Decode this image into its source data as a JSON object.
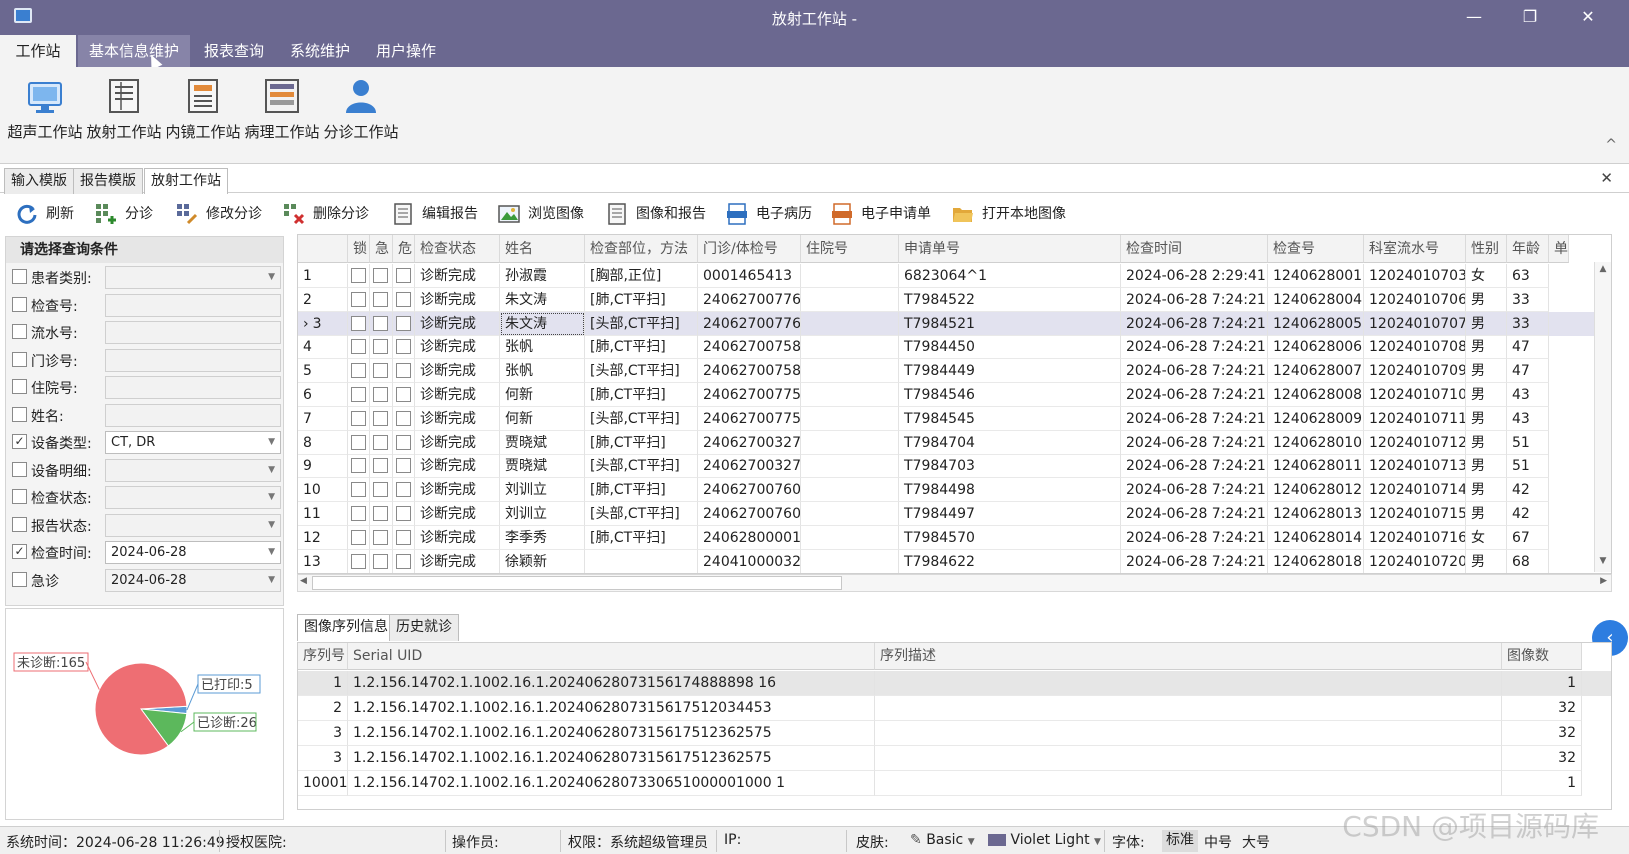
{
  "window": {
    "title": "放射工作站 -",
    "minimize": "—",
    "maximize": "❐",
    "close": "✕"
  },
  "menu": [
    "工作站",
    "基本信息维护",
    "报表查询",
    "系统维护",
    "用户操作"
  ],
  "ribbon": {
    "buttons": [
      {
        "label": "超声工作站",
        "icon": "monitor-icon"
      },
      {
        "label": "放射工作站",
        "icon": "document-icon"
      },
      {
        "label": "内镜工作站",
        "icon": "list-icon"
      },
      {
        "label": "病理工作站",
        "icon": "table-icon"
      },
      {
        "label": "分诊工作站",
        "icon": "user-icon"
      }
    ],
    "collapse": "^"
  },
  "doc_tabs": [
    "输入模版",
    "报告模版",
    "放射工作站"
  ],
  "doc_close": "✕",
  "toolbar": [
    "刷新",
    "分诊",
    "修改分诊",
    "删除分诊",
    "编辑报告",
    "浏览图像",
    "图像和报告",
    "电子病历",
    "电子申请单",
    "打开本地图像"
  ],
  "filters": {
    "header": "请选择查询条件",
    "rows": [
      {
        "label": "患者类别:",
        "checked": false,
        "value": "",
        "dropdown": true
      },
      {
        "label": "检查号:",
        "checked": false,
        "value": "",
        "dropdown": false
      },
      {
        "label": "流水号:",
        "checked": false,
        "value": "",
        "dropdown": false
      },
      {
        "label": "门诊号:",
        "checked": false,
        "value": "",
        "dropdown": false
      },
      {
        "label": "住院号:",
        "checked": false,
        "value": "",
        "dropdown": false
      },
      {
        "label": "姓名:",
        "checked": false,
        "value": "",
        "dropdown": false
      },
      {
        "label": "设备类型:",
        "checked": true,
        "value": "CT, DR",
        "dropdown": true
      },
      {
        "label": "设备明细:",
        "checked": false,
        "value": "",
        "dropdown": true
      },
      {
        "label": "检查状态:",
        "checked": false,
        "value": "",
        "dropdown": true
      },
      {
        "label": "报告状态:",
        "checked": false,
        "value": "",
        "dropdown": true
      },
      {
        "label": "检查时间:",
        "checked": true,
        "value": "2024-06-28",
        "dropdown": true
      },
      {
        "label": "急诊",
        "checked": false,
        "value": "2024-06-28",
        "dropdown": true
      }
    ]
  },
  "pie": {
    "labels": {
      "undiagnosed": "未诊断:165",
      "printed": "已打印:5",
      "diagnosed": "已诊断:26"
    },
    "values": {
      "undiagnosed": 165,
      "printed": 5,
      "diagnosed": 26
    },
    "colors": {
      "undiagnosed": "#ee6e73",
      "printed": "#5b9bd5",
      "diagnosed": "#5cb85c"
    }
  },
  "grid": {
    "columns": [
      "",
      "锁",
      "急",
      "危",
      "检查状态",
      "姓名",
      "检查部位，方法",
      "门诊/体检号",
      "住院号",
      "申请单号",
      "检查时间",
      "检查号",
      "科室流水号",
      "性别",
      "年龄",
      "单"
    ],
    "rows": [
      [
        "1",
        "诊断完成",
        "孙淑霞",
        "[胸部,正位]",
        "0001465413",
        "",
        "6823064^1",
        "2024-06-28 2:29:41",
        "1240628001",
        "12024010703",
        "女",
        "63"
      ],
      [
        "2",
        "诊断完成",
        "朱文涛",
        "[肺,CT平扫]",
        "24062700776",
        "",
        "T7984522",
        "2024-06-28 7:24:21",
        "1240628004",
        "12024010706",
        "男",
        "33"
      ],
      [
        "3",
        "诊断完成",
        "朱文涛",
        "[头部,CT平扫]",
        "24062700776",
        "",
        "T7984521",
        "2024-06-28 7:24:21",
        "1240628005",
        "12024010707",
        "男",
        "33"
      ],
      [
        "4",
        "诊断完成",
        "张帆",
        "[肺,CT平扫]",
        "24062700758",
        "",
        "T7984450",
        "2024-06-28 7:24:21",
        "1240628006",
        "12024010708",
        "男",
        "47"
      ],
      [
        "5",
        "诊断完成",
        "张帆",
        "[头部,CT平扫]",
        "24062700758",
        "",
        "T7984449",
        "2024-06-28 7:24:21",
        "1240628007",
        "12024010709",
        "男",
        "47"
      ],
      [
        "6",
        "诊断完成",
        "何新",
        "[肺,CT平扫]",
        "24062700775",
        "",
        "T7984546",
        "2024-06-28 7:24:21",
        "1240628008",
        "12024010710",
        "男",
        "43"
      ],
      [
        "7",
        "诊断完成",
        "何新",
        "[头部,CT平扫]",
        "24062700775",
        "",
        "T7984545",
        "2024-06-28 7:24:21",
        "1240628009",
        "12024010711",
        "男",
        "43"
      ],
      [
        "8",
        "诊断完成",
        "贾晓斌",
        "[肺,CT平扫]",
        "24062700327",
        "",
        "T7984704",
        "2024-06-28 7:24:21",
        "1240628010",
        "12024010712",
        "男",
        "51"
      ],
      [
        "9",
        "诊断完成",
        "贾晓斌",
        "[头部,CT平扫]",
        "24062700327",
        "",
        "T7984703",
        "2024-06-28 7:24:21",
        "1240628011",
        "12024010713",
        "男",
        "51"
      ],
      [
        "10",
        "诊断完成",
        "刘训立",
        "[肺,CT平扫]",
        "24062700760",
        "",
        "T7984498",
        "2024-06-28 7:24:21",
        "1240628012",
        "12024010714",
        "男",
        "42"
      ],
      [
        "11",
        "诊断完成",
        "刘训立",
        "[头部,CT平扫]",
        "24062700760",
        "",
        "T7984497",
        "2024-06-28 7:24:21",
        "1240628013",
        "12024010715",
        "男",
        "42"
      ],
      [
        "12",
        "诊断完成",
        "李季秀",
        "[肺,CT平扫]",
        "24062800001",
        "",
        "T7984570",
        "2024-06-28 7:24:21",
        "1240628014",
        "12024010716",
        "女",
        "67"
      ],
      [
        "13",
        "诊断完成",
        "徐颖新",
        "",
        "24041000032",
        "",
        "T7984622",
        "2024-06-28 7:24:21",
        "1240628018",
        "12024010720",
        "男",
        "68"
      ]
    ],
    "selected_row": 3,
    "row_indicator": "›"
  },
  "lower_tabs": [
    "图像序列信息",
    "历史就诊"
  ],
  "seq_grid": {
    "columns": [
      "序列号",
      "Serial UID",
      "序列描述",
      "图像数"
    ],
    "rows": [
      [
        "1",
        "1.2.156.14702.1.1002.16.1.20240628073156174888898 16",
        "",
        "1"
      ],
      [
        "2",
        "1.2.156.14702.1.1002.16.1.2024062807315617512034453",
        "",
        "32"
      ],
      [
        "3",
        "1.2.156.14702.1.1002.16.1.2024062807315617512362575",
        "",
        "32"
      ],
      [
        "3",
        "1.2.156.14702.1.1002.16.1.2024062807315617512362575",
        "",
        "32"
      ],
      [
        "10001",
        "1.2.156.14702.1.1002.16.1.2024062807330651000001000 1",
        "",
        "1"
      ]
    ]
  },
  "status": {
    "system_time": "系统时间：2024-06-28 11:26:49",
    "hospital": "授权医院:",
    "operator": "操作员:",
    "permission": "权限：系统超级管理员",
    "ip": "IP:",
    "skin_label": "皮肤:",
    "skin_basic": "Basic",
    "skin_theme": "Violet Light",
    "font_label": "字体:",
    "font_options": [
      "标准",
      "中号",
      "大号"
    ]
  },
  "watermark": "CSDN @项目源码库"
}
